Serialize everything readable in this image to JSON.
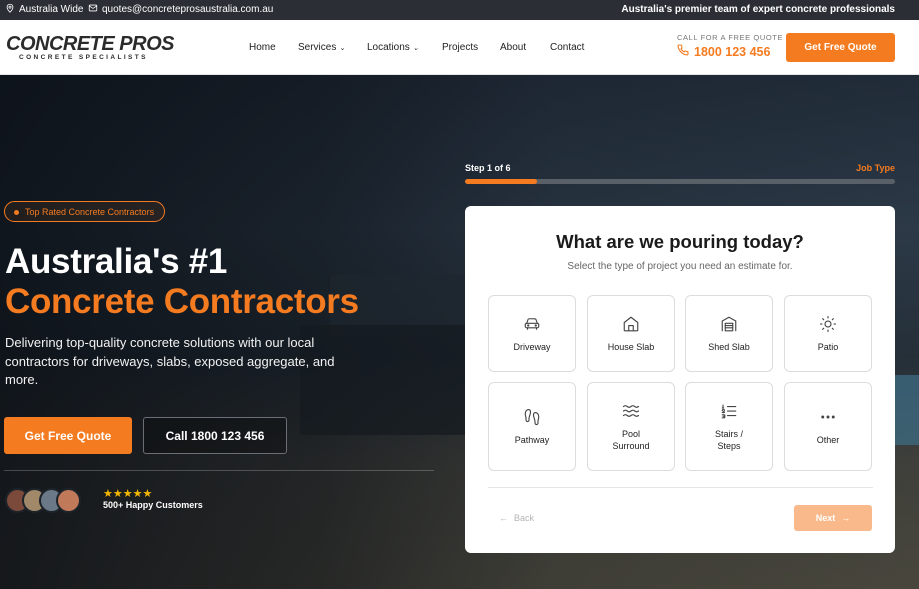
{
  "topbar": {
    "location": "Australia Wide",
    "email": "quotes@concreteprosaustralia.com.au",
    "tagline": "Australia's premier team of expert concrete professionals"
  },
  "header": {
    "logo_name": "CONCRETE PROS",
    "logo_sub": "CONCRETE SPECIALISTS",
    "nav": [
      "Home",
      "Services",
      "Locations",
      "Projects",
      "About",
      "Contact"
    ],
    "call_label": "CALL FOR A FREE QUOTE",
    "phone": "1800 123 456",
    "cta": "Get Free Quote"
  },
  "hero": {
    "badge": "Top Rated Concrete Contractors",
    "heading_line1": "Australia's #1",
    "heading_line2": "Concrete Contractors",
    "description": "Delivering top-quality concrete solutions with our local contractors for driveways, slabs, exposed aggregate, and more.",
    "btn_quote": "Get Free Quote",
    "btn_call": "Call 1800 123 456",
    "stars": "★★★★★",
    "customers": "500+ Happy Customers",
    "accent": "#f47b20"
  },
  "quote": {
    "step_label": "Step 1 of 6",
    "step_name": "Job Type",
    "progress": 0.1667,
    "title": "What are we pouring today?",
    "subtitle": "Select the type of project you need an estimate for.",
    "options": [
      {
        "label": "Driveway",
        "icon": "car-icon"
      },
      {
        "label": "House Slab",
        "icon": "house-icon"
      },
      {
        "label": "Shed Slab",
        "icon": "warehouse-icon"
      },
      {
        "label": "Patio",
        "icon": "sun-icon"
      },
      {
        "label": "Pathway",
        "icon": "footprints-icon"
      },
      {
        "label": "Pool\nSurround",
        "icon": "waves-icon"
      },
      {
        "label": "Stairs /\nSteps",
        "icon": "list-steps-icon"
      },
      {
        "label": "Other",
        "icon": "more-icon"
      }
    ],
    "back": "Back",
    "next": "Next"
  }
}
